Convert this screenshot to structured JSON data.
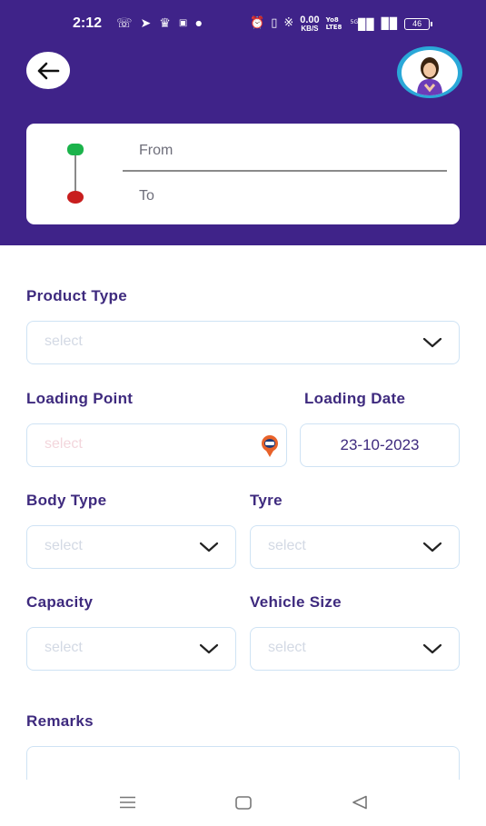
{
  "status_bar": {
    "time": "2:12",
    "net_speed_value": "0.00",
    "net_speed_unit": "KB/S",
    "network_type": "Yo8 LTE8",
    "signal_label": "5G",
    "battery": "46"
  },
  "route": {
    "from_placeholder": "From",
    "to_placeholder": "To",
    "from_dot_color": "#1bb34b",
    "to_dot_color": "#c81e1e"
  },
  "form": {
    "product_type": {
      "label": "Product Type",
      "placeholder": "select"
    },
    "loading_point": {
      "label": "Loading Point",
      "placeholder": "select"
    },
    "loading_date": {
      "label": "Loading Date",
      "value": "23-10-2023"
    },
    "body_type": {
      "label": "Body Type",
      "placeholder": "select"
    },
    "tyre": {
      "label": "Tyre",
      "placeholder": "select"
    },
    "capacity": {
      "label": "Capacity",
      "placeholder": "select"
    },
    "vehicle_size": {
      "label": "Vehicle Size",
      "placeholder": "select"
    },
    "remarks": {
      "label": "Remarks",
      "value": ""
    }
  },
  "colors": {
    "header_bg": "#3f2389",
    "label_text": "#3e2a7e",
    "field_border": "#cfe3f4"
  },
  "icons": {
    "back": "arrow-left-icon",
    "avatar": "assistant-avatar",
    "dropdown": "chevron-down-icon",
    "location": "location-pin-icon"
  }
}
